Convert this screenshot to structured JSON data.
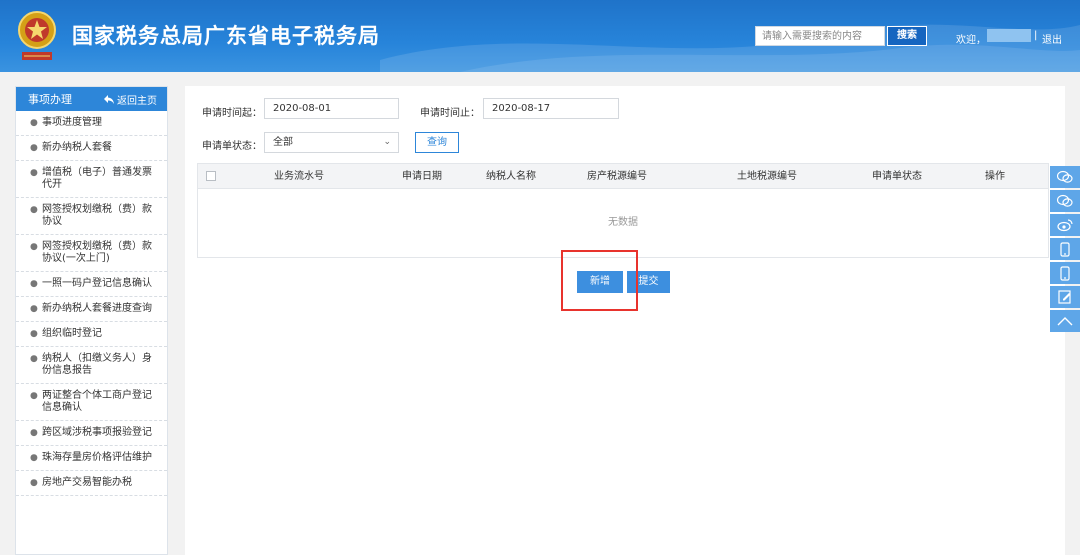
{
  "header": {
    "title": "国家税务总局广东省电子税务局",
    "search_placeholder": "请输入需要搜索的内容",
    "search_button": "搜索",
    "welcome": "欢迎，",
    "separator": "|",
    "logout": "退出"
  },
  "sidebar": {
    "title": "事项办理",
    "back_home": "返回主页",
    "items": [
      {
        "label": "事项进度管理"
      },
      {
        "label": "新办纳税人套餐"
      },
      {
        "label": "增值税（电子）普通发票代开"
      },
      {
        "label": "网签授权划缴税（费）款协议"
      },
      {
        "label": "网签授权划缴税（费）款协议(一次上门)"
      },
      {
        "label": "一照一码户登记信息确认"
      },
      {
        "label": "新办纳税人套餐进度查询"
      },
      {
        "label": "组织临时登记"
      },
      {
        "label": "纳税人（扣缴义务人）身份信息报告"
      },
      {
        "label": "两证整合个体工商户登记信息确认"
      },
      {
        "label": "跨区域涉税事项报验登记"
      },
      {
        "label": "珠海存量房价格评估维护"
      },
      {
        "label": "房地产交易智能办税"
      }
    ]
  },
  "form": {
    "start_label": "申请时间起：",
    "start_value": "2020-08-01",
    "end_label": "申请时间止：",
    "end_value": "2020-08-17",
    "status_label": "申请单状态：",
    "status_value": "全部",
    "query_button": "查询"
  },
  "table": {
    "columns": [
      "业务流水号",
      "申请日期",
      "纳税人名称",
      "房产税源编号",
      "土地税源编号",
      "申请单状态",
      "操作"
    ],
    "empty_text": "无数据"
  },
  "actions": {
    "add_button": "新增",
    "submit_button": "提交"
  },
  "colors": {
    "header_blue": "#2784da",
    "accent_blue": "#3d8fdf",
    "highlight_red": "#e8332d"
  }
}
